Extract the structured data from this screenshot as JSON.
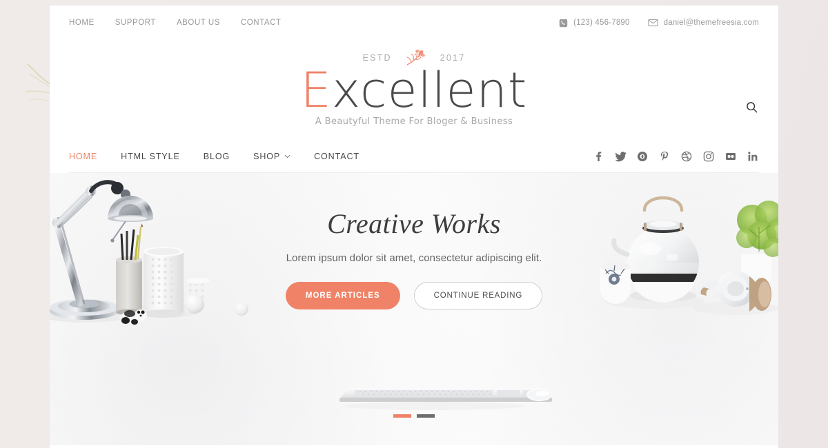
{
  "topbar": {
    "nav": [
      {
        "label": "HOME"
      },
      {
        "label": "SUPPORT"
      },
      {
        "label": "ABOUT US"
      },
      {
        "label": "CONTACT"
      }
    ],
    "phone_icon": "phone-icon",
    "phone": "(123) 456-7890",
    "email_icon": "envelope-icon",
    "email": "daniel@themefreesia.com"
  },
  "brand": {
    "estd_label": "ESTD",
    "estd_year": "2017",
    "ornament_icon": "floral-branch-icon",
    "logo_initial": "E",
    "logo_rest": "xcellent",
    "tagline": "A Beautyful Theme For Bloger & Business",
    "search_icon": "search-icon",
    "accent_color": "#ef8268",
    "text_color": "#4a4a4a"
  },
  "mainnav": {
    "items": [
      {
        "label": "HOME",
        "active": true,
        "has_dropdown": false
      },
      {
        "label": "HTML STYLE",
        "active": false,
        "has_dropdown": false
      },
      {
        "label": "BLOG",
        "active": false,
        "has_dropdown": false
      },
      {
        "label": "SHOP",
        "active": false,
        "has_dropdown": true
      },
      {
        "label": "CONTACT",
        "active": false,
        "has_dropdown": false
      }
    ],
    "dropdown_icon": "chevron-down-icon",
    "social": [
      {
        "name": "facebook-icon"
      },
      {
        "name": "twitter-icon"
      },
      {
        "name": "google-plus-icon"
      },
      {
        "name": "pinterest-icon"
      },
      {
        "name": "dribbble-icon"
      },
      {
        "name": "instagram-icon"
      },
      {
        "name": "flickr-icon"
      },
      {
        "name": "linkedin-icon"
      }
    ]
  },
  "hero": {
    "title": "Creative Works",
    "subtitle": "Lorem ipsum dolor sit amet, consectetur adipiscing elit.",
    "primary_button": "MORE ARTICLES",
    "secondary_button": "CONTINUE READING",
    "slides": [
      {
        "active": true
      },
      {
        "active": false
      }
    ],
    "left_scene": "desk-lamp-pen-holder-vase-panda-photo",
    "center_scene": "keyboard-and-mouse-photo",
    "right_scene": "teapot-cup-plant-headphones-photo",
    "primary_color": "#f08367",
    "inactive_dot_color": "#6d6d6d"
  }
}
